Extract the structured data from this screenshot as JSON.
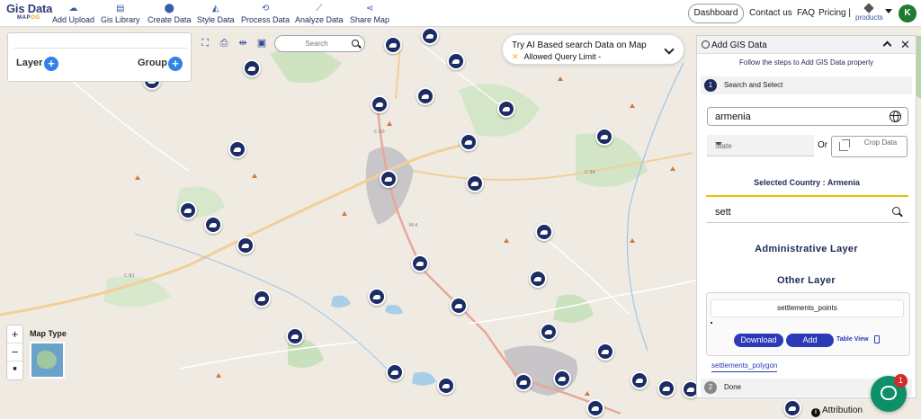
{
  "brand": {
    "title": "Gis Data",
    "subtitle_a": "MAP",
    "subtitle_b": "OG"
  },
  "nav": {
    "items": [
      {
        "label": "Add Upload",
        "icon": "cloud-upload-icon"
      },
      {
        "label": "Gis Library",
        "icon": "library-icon"
      },
      {
        "label": "Create Data",
        "icon": "map-pin-icon"
      },
      {
        "label": "Style Data",
        "icon": "paint-bucket-icon"
      },
      {
        "label": "Process Data",
        "icon": "process-icon"
      },
      {
        "label": "Analyze Data",
        "icon": "analyze-icon"
      },
      {
        "label": "Share Map",
        "icon": "share-icon"
      }
    ],
    "dashboard": "Dashboard",
    "contact": "Contact us",
    "faq": "FAQ",
    "pricing": "Pricing |",
    "products": "products",
    "avatar": "K"
  },
  "layer_panel": {
    "layer_label": "Layer",
    "group_label": "Group"
  },
  "map_search": {
    "placeholder": "Search"
  },
  "ai_banner": {
    "line1": "Try AI Based search Data on Map",
    "line2": "Allowed Query Limit -",
    "line2_prefix": "✕"
  },
  "side_panel": {
    "title": "Add GIS Data",
    "subtitle": "Follow the steps to Add GIS Data properly",
    "step1": {
      "num": "1",
      "label": "Search and Select"
    },
    "country_value": "armenia",
    "state_placeholder": "State",
    "or_label": "Or",
    "crop_label": "Crop Data",
    "selected_country": "Selected Country : Armenia",
    "filter_value": "sett",
    "admin_layer": "Administrative Layer",
    "other_layer": "Other Layer",
    "layer_card": {
      "name": "settlements_points",
      "download": "Download",
      "add": "Add",
      "table_view": "Table View"
    },
    "link_layer": "settlements_polygon",
    "step2": {
      "num": "2",
      "label": "Done"
    }
  },
  "map_controls": {
    "zoom_in": "+",
    "zoom_out": "−",
    "reset": "■",
    "map_type": "Map Type"
  },
  "attribution": "Attribution",
  "chat": {
    "badge": "1"
  },
  "colors": {
    "brand": "#2d3d7a",
    "accent": "#2c3ab8",
    "marker": "#1c2c64",
    "chat": "#0d8f68"
  }
}
